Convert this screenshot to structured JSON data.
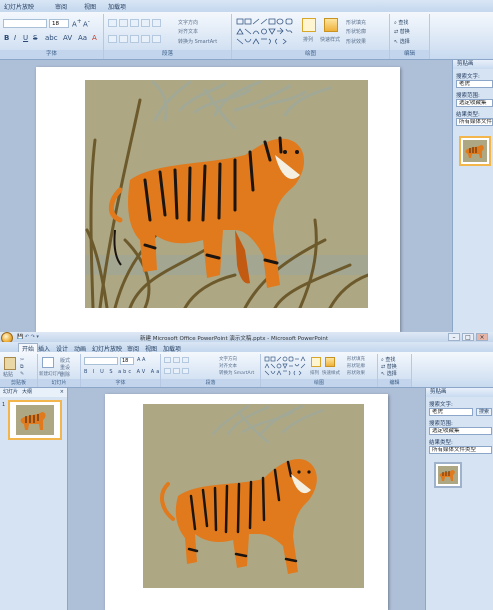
{
  "top": {
    "tabs": [
      "幻灯片放映",
      "审阅",
      "视图",
      "加载项"
    ],
    "groups": {
      "font": {
        "label": "字体",
        "size": "18"
      },
      "paragraph": {
        "label": "段落",
        "text_direction": "文字方向",
        "align_text": "对齐文本",
        "convert_smartart": "转换为 SmartArt"
      },
      "drawing": {
        "label": "绘图",
        "arrange": "排列",
        "quick_styles": "快速样式",
        "shape_fill": "形状填充",
        "shape_outline": "形状轮廓",
        "shape_effects": "形状效果"
      },
      "editing": {
        "label": "编辑",
        "find": "查找",
        "replace": "替换",
        "select": "选择"
      }
    },
    "clipart_pane": {
      "title": "剪贴画",
      "search_label": "搜索文字:",
      "search_value": "老虎",
      "search_in_label": "搜索范围:",
      "search_in_value": "选定收藏集",
      "results_label": "结果类型:",
      "results_value": "所有媒体文件类型"
    }
  },
  "bottom": {
    "title": "新建 Microsoft Office PowerPoint 演示文稿.pptx - Microsoft PowerPoint",
    "tabs": [
      "开始",
      "插入",
      "设计",
      "动画",
      "幻灯片放映",
      "审阅",
      "视图",
      "加载项"
    ],
    "groups": {
      "clipboard": {
        "label": "剪贴板",
        "paste": "粘贴"
      },
      "slides": {
        "label": "幻灯片",
        "new_slide": "新建幻灯片",
        "layout": "版式",
        "reset": "重设",
        "delete": "删除"
      },
      "font": {
        "label": "字体",
        "size": "18"
      },
      "paragraph": {
        "label": "段落",
        "text_direction": "文字方向",
        "align_text": "对齐文本",
        "convert_smartart": "转换为 SmartArt"
      },
      "drawing": {
        "label": "绘图",
        "arrange": "排列",
        "quick_styles": "快速样式",
        "shape_fill": "形状填充",
        "shape_outline": "形状轮廓",
        "shape_effects": "形状效果"
      },
      "editing": {
        "label": "编辑",
        "find": "查找",
        "replace": "替换",
        "select": "选择"
      }
    },
    "slides_pane": {
      "tab_slides": "幻灯片",
      "tab_outline": "大纲",
      "slide_number": "1"
    },
    "clipart_pane": {
      "title": "剪贴画",
      "search_label": "搜索文字:",
      "search_value": "老虎",
      "search_button": "搜索",
      "search_in_label": "搜索范围:",
      "search_in_value": "选定收藏集",
      "results_label": "结果类型:",
      "results_value": "所有媒体文件类型"
    }
  },
  "colors": {
    "picture_bg": "#aea783",
    "tiger_orange": "#e07a1c",
    "stripe": "#1b1411",
    "grass": "#6c5a2d",
    "selection_border": "#f3b64d"
  }
}
